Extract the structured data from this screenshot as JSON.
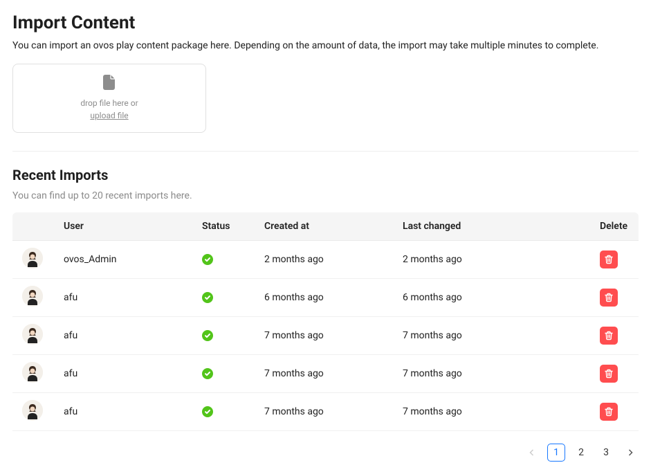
{
  "page": {
    "title": "Import Content",
    "description": "You can import an ovos play content package here. Depending on the amount of data, the import may take multiple minutes to complete."
  },
  "dropzone": {
    "drop_label": "drop file here or",
    "upload_label": "upload file"
  },
  "recent": {
    "title": "Recent Imports",
    "description": "You can find up to 20 recent imports here."
  },
  "table": {
    "headers": {
      "user": "User",
      "status": "Status",
      "created": "Created at",
      "changed": "Last changed",
      "delete": "Delete"
    },
    "rows": [
      {
        "user": "ovos_Admin",
        "status": "success",
        "created": "2 months ago",
        "changed": "2 months ago"
      },
      {
        "user": "afu",
        "status": "success",
        "created": "6 months ago",
        "changed": "6 months ago"
      },
      {
        "user": "afu",
        "status": "success",
        "created": "7 months ago",
        "changed": "7 months ago"
      },
      {
        "user": "afu",
        "status": "success",
        "created": "7 months ago",
        "changed": "7 months ago"
      },
      {
        "user": "afu",
        "status": "success",
        "created": "7 months ago",
        "changed": "7 months ago"
      }
    ]
  },
  "pagination": {
    "pages": [
      "1",
      "2",
      "3"
    ],
    "active": "1"
  }
}
